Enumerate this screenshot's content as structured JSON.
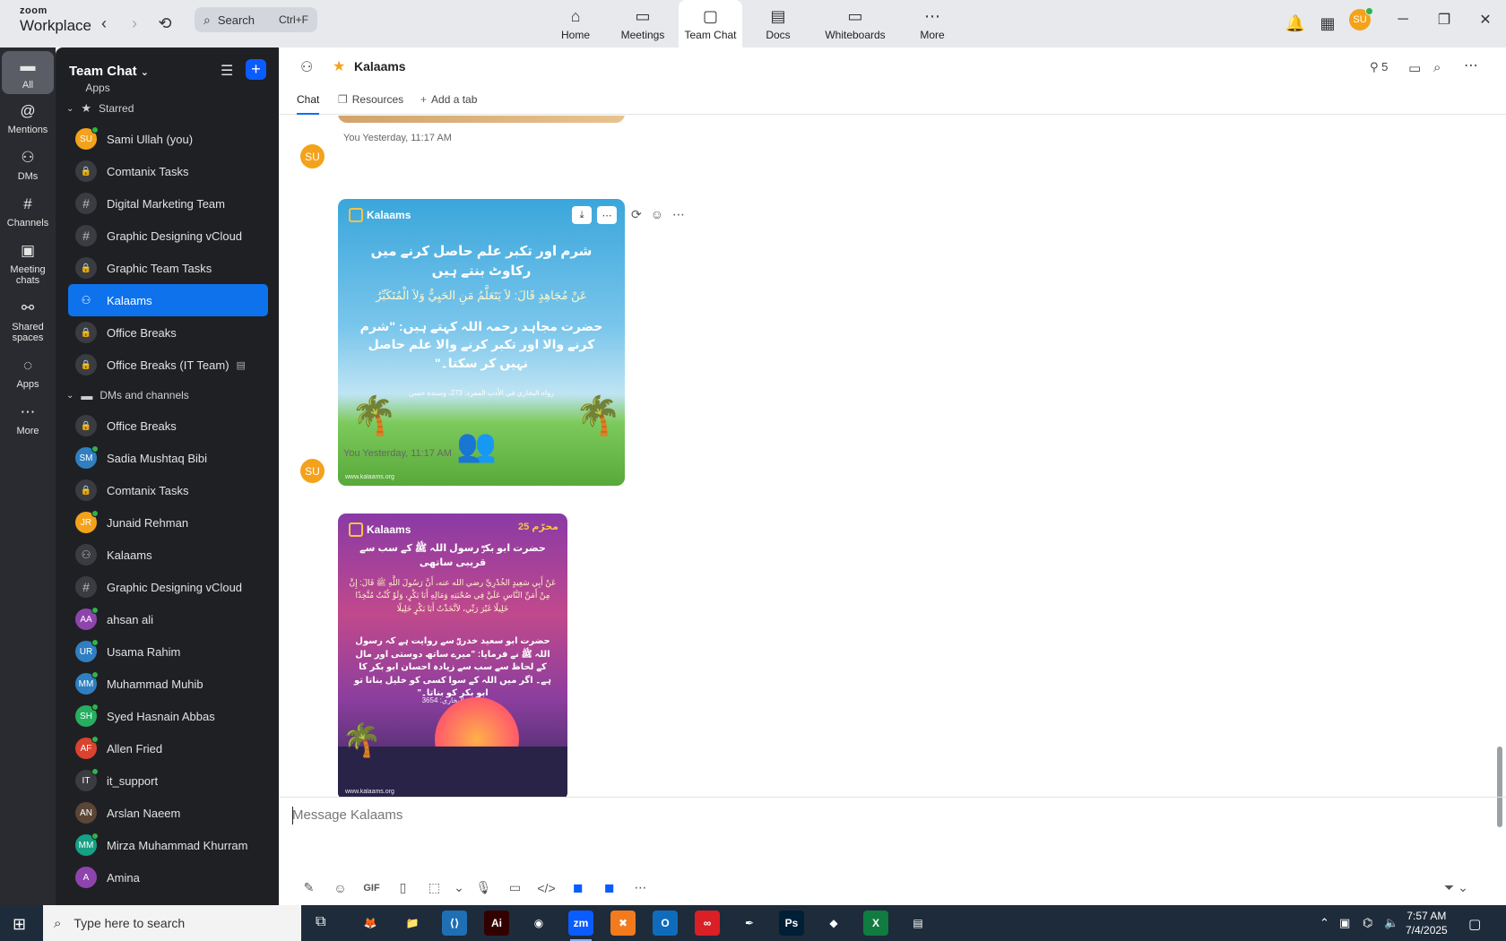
{
  "brand": {
    "line1": "zoom",
    "line2": "Workplace"
  },
  "search": {
    "label": "Search",
    "shortcut": "Ctrl+F"
  },
  "nav_tabs": [
    {
      "label": "Home",
      "icon": "home-icon"
    },
    {
      "label": "Meetings",
      "icon": "video-camera-icon"
    },
    {
      "label": "Team Chat",
      "icon": "chat-bubble-icon"
    },
    {
      "label": "Docs",
      "icon": "document-icon"
    },
    {
      "label": "Whiteboards",
      "icon": "whiteboard-icon"
    },
    {
      "label": "More",
      "icon": "more-dots-icon"
    }
  ],
  "user": {
    "initials": "SU"
  },
  "rail": [
    {
      "label": "All"
    },
    {
      "label": "Mentions"
    },
    {
      "label": "DMs"
    },
    {
      "label": "Channels"
    },
    {
      "label": "Meeting chats"
    },
    {
      "label": "Shared spaces"
    },
    {
      "label": "Apps"
    },
    {
      "label": "More"
    }
  ],
  "sidebar": {
    "title": "Team Chat",
    "cut_off_item": "Apps",
    "starred_label": "Starred",
    "starred": [
      {
        "name": "Sami Ullah (you)",
        "initials": "SU",
        "color": "#f4a21b",
        "kind": "user",
        "online": true
      },
      {
        "name": "Comtanix Tasks",
        "kind": "lock"
      },
      {
        "name": "Digital Marketing Team",
        "kind": "hash"
      },
      {
        "name": "Graphic Designing vCloud",
        "kind": "hash"
      },
      {
        "name": "Graphic Team Tasks",
        "kind": "lock"
      },
      {
        "name": "Kalaams",
        "kind": "group",
        "active": true
      },
      {
        "name": "Office Breaks",
        "kind": "lock"
      },
      {
        "name": "Office Breaks (IT Team)",
        "kind": "lock",
        "archived": true
      }
    ],
    "dms_label": "DMs and channels",
    "dms": [
      {
        "name": "Office Breaks",
        "kind": "lock"
      },
      {
        "name": "Sadia Mushtaq Bibi",
        "initials": "SM",
        "color": "#2f7fc1",
        "kind": "user",
        "online": true
      },
      {
        "name": "Comtanix Tasks",
        "kind": "lock"
      },
      {
        "name": "Junaid Rehman",
        "initials": "JR",
        "color": "#f4a21b",
        "kind": "user",
        "online": true
      },
      {
        "name": "Kalaams",
        "kind": "group"
      },
      {
        "name": "Graphic Designing vCloud",
        "kind": "hash"
      },
      {
        "name": "ahsan ali",
        "initials": "AA",
        "color": "#8e44ad",
        "kind": "user",
        "online": true
      },
      {
        "name": "Usama Rahim",
        "initials": "UR",
        "color": "#2f7fc1",
        "kind": "user",
        "online": true
      },
      {
        "name": "Muhammad Muhib",
        "initials": "MM",
        "color": "#2f7fc1",
        "kind": "user",
        "online": true
      },
      {
        "name": "Syed Hasnain Abbas",
        "initials": "SH",
        "color": "#27ae60",
        "kind": "user",
        "online": true
      },
      {
        "name": "Allen Fried",
        "initials": "AF",
        "color": "#d9432f",
        "kind": "user",
        "online": true
      },
      {
        "name": "it_support",
        "initials": "IT",
        "color": "#3a3c42",
        "kind": "user",
        "online": true
      },
      {
        "name": "Arslan Naeem",
        "initials": "AN",
        "color": "#5b4636",
        "kind": "user",
        "online": false
      },
      {
        "name": "Mirza Muhammad Khurram",
        "initials": "MM",
        "color": "#16a085",
        "kind": "user",
        "online": true
      },
      {
        "name": "Amina",
        "initials": "A",
        "color": "#8e44ad",
        "kind": "user",
        "online": false
      }
    ]
  },
  "channel": {
    "title": "Kalaams",
    "member_count": "5",
    "tabs": {
      "chat": "Chat",
      "resources": "Resources",
      "add": "Add a tab"
    }
  },
  "messages": [
    {
      "sender": "You",
      "time": "Yesterday, 11:17 AM",
      "initials": "SU",
      "card": {
        "logo": "Kalaams",
        "headline": "شرم اور تکبر علم حاصل کرنے میں رکاوٹ بنتے ہیں",
        "arabic": "عَنْ مُجَاهِدٍ قَالَ: لاَ يَتَعَلَّمُ مَنِ الحَيِيُّ وَلاَ الْمُتَكَبِّرُ",
        "urdu": "حضرت مجاہد رحمہ اللہ کہتے ہیں: \"شرم کرنے والا اور تکبر کرنے والا علم حاصل نہیں کر سکتا۔\"",
        "reference": "رواه البخاري في الأدب المفرد: 273، وسنده حسن",
        "site": "www.kalaams.org"
      }
    },
    {
      "sender": "You",
      "time": "Yesterday, 11:17 AM",
      "initials": "SU",
      "card": {
        "logo": "Kalaams",
        "corner": "محرّم 25",
        "headline": "حضرت ابو بکرؓ رسول اللہ ﷺ کے سب سے قریبی ساتھی",
        "arabic": "عَنْ أَبِي سَعِيدٍ الخُدْرِيِّ رضي الله عنه، أَنَّ رَسُولَ اللَّهِ ﷺ قَالَ: إِنَّ مِنْ أَمَنِّ النَّاسِ عَلَيَّ فِي صُحْبَتِهِ وَمَالِهِ أَبَا بَكْرٍ، وَلَوْ كُنْتُ مُتَّخِذًا خَلِيلًا غَيْرَ رَبِّي، لاَتَّخَذْتُ أَبَا بَكْرٍ خَلِيلًا",
        "urdu": "حضرت ابو سعید خدریؓ سے روایت ہے کہ رسول اللہ ﷺ نے فرمایا: \"میرے ساتھ دوستی اور مال کے لحاظ سے سب سے زیادہ احسان ابو بکر کا ہے۔ اگر میں اللہ کے سوا کسی کو خلیل بناتا تو ابو بکر کو بناتا۔\"",
        "reference": "صحيح البخاري: 3654",
        "site": "www.kalaams.org"
      }
    }
  ],
  "composer": {
    "placeholder": "Message Kalaams"
  },
  "taskbar": {
    "search_placeholder": "Type here to search",
    "time": "7:57 AM",
    "date": "7/4/2025",
    "apps": [
      {
        "label": "Firefox",
        "glyph": "🦊",
        "color": "#1e2b3a"
      },
      {
        "label": "File Explorer",
        "glyph": "📁",
        "color": "#1e2b3a"
      },
      {
        "label": "VS Code",
        "glyph": "⟨⟩",
        "color": "#1f6fb5"
      },
      {
        "label": "Illustrator",
        "glyph": "Ai",
        "color": "#330000"
      },
      {
        "label": "Chrome",
        "glyph": "◉",
        "color": "#1e2b3a"
      },
      {
        "label": "Zoom",
        "glyph": "zm",
        "color": "#0b5cff"
      },
      {
        "label": "XAMPP",
        "glyph": "✖",
        "color": "#f37b1d"
      },
      {
        "label": "Outlook",
        "glyph": "O",
        "color": "#0f6cbd"
      },
      {
        "label": "Creative Cloud",
        "glyph": "∞",
        "color": "#da1f26"
      },
      {
        "label": "Pen Tool",
        "glyph": "✒",
        "color": "#1e2b3a"
      },
      {
        "label": "Photoshop",
        "glyph": "Ps",
        "color": "#001e36"
      },
      {
        "label": "App",
        "glyph": "◆",
        "color": "#1e2b3a"
      },
      {
        "label": "Excel",
        "glyph": "X",
        "color": "#107c41"
      },
      {
        "label": "Notepad",
        "glyph": "▤",
        "color": "#1e2b3a"
      }
    ]
  }
}
